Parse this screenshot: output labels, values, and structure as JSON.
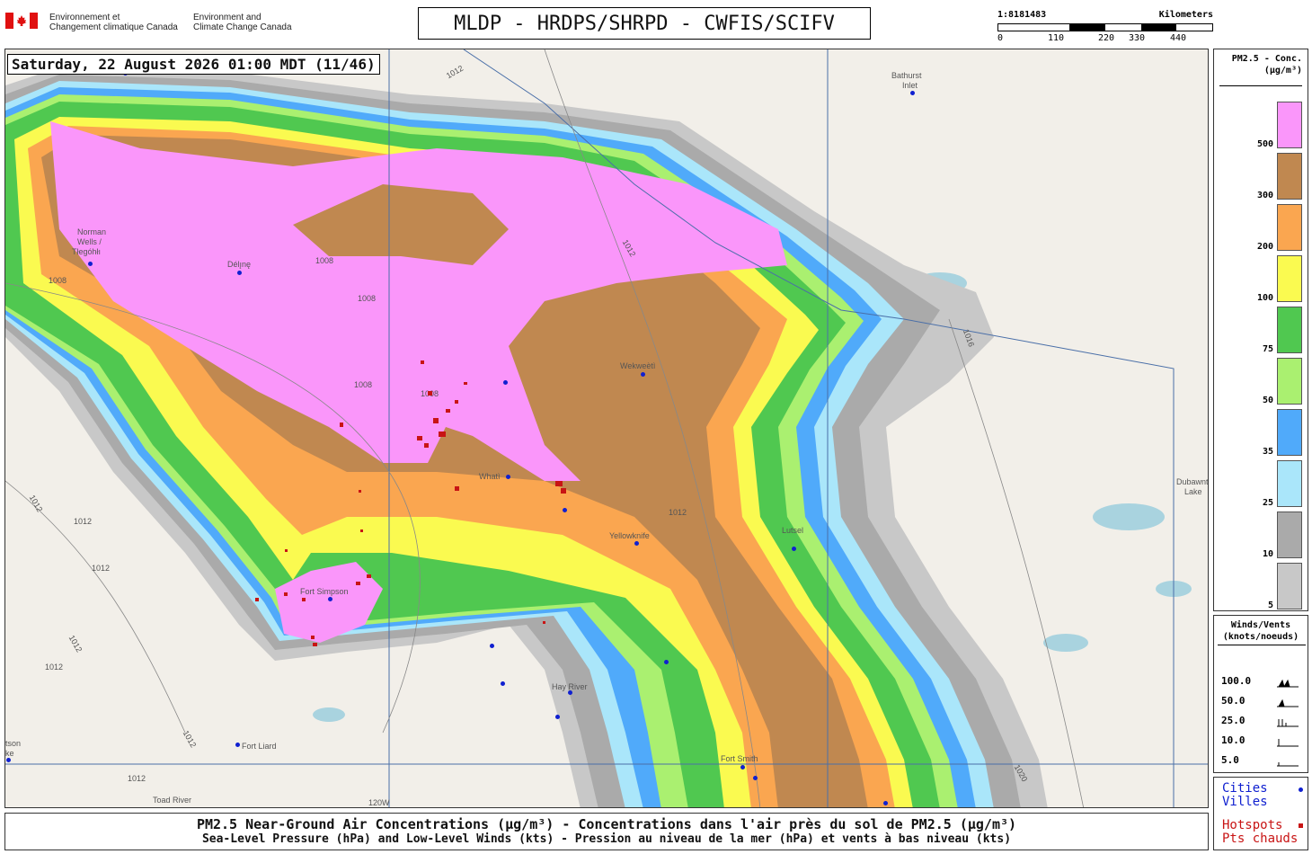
{
  "header": {
    "gov_fr_line1": "Environnement et",
    "gov_fr_line2": "Changement climatique Canada",
    "gov_en_line1": "Environment and",
    "gov_en_line2": "Climate Change Canada",
    "title": "MLDP - HRDPS/SHRPD - CWFIS/SCIFV",
    "scale_ratio": "1:8181483",
    "scale_unit": "Kilometers",
    "scale_ticks": [
      "0",
      "110",
      "220",
      "330",
      "440"
    ]
  },
  "map": {
    "timestamp": "Saturday, 22 August 2026 01:00 MDT (11/46)",
    "cities": [
      {
        "name": "Bathurst",
        "name2": "Inlet"
      },
      {
        "name": "Norman",
        "name2": "Wells /"
      },
      {
        "name": "Tłegóhłı"
      },
      {
        "name": "Délı̨nę"
      },
      {
        "name": "Wekweètì"
      },
      {
        "name": "Whatì"
      },
      {
        "name": "Yellowknife"
      },
      {
        "name": "Lutsel"
      },
      {
        "name": "Fort Simpson"
      },
      {
        "name": "Hay River"
      },
      {
        "name": "Fort Liard"
      },
      {
        "name": "Fort Smith"
      },
      {
        "name": "Toad River"
      },
      {
        "name": "Dubawnt"
      },
      {
        "name": "Lake"
      },
      {
        "name": "tson"
      },
      {
        "name": "ke"
      },
      {
        "name": "120W"
      }
    ],
    "isobar_labels": [
      "1012",
      "1008",
      "1008",
      "1008",
      "1016",
      "1012",
      "1012",
      "1012",
      "1012",
      "1012",
      "1012",
      "1012",
      "1008",
      "1012",
      "1012",
      "1020",
      "1008"
    ]
  },
  "legend": {
    "title_line1": "PM2.5 - Conc.",
    "title_line2": "(µg/m³)",
    "levels": [
      {
        "label": "500",
        "color": "#fa96fa"
      },
      {
        "label": "300",
        "color": "#c08850"
      },
      {
        "label": "200",
        "color": "#faa650"
      },
      {
        "label": "100",
        "color": "#fafa50"
      },
      {
        "label": "75",
        "color": "#50c850"
      },
      {
        "label": "50",
        "color": "#aaf070"
      },
      {
        "label": "35",
        "color": "#50aafa"
      },
      {
        "label": "25",
        "color": "#aae6fa"
      },
      {
        "label": "10",
        "color": "#aaaaaa"
      },
      {
        "label": "5",
        "color": "#c8c8c8"
      }
    ]
  },
  "winds": {
    "title_line1": "Winds/Vents",
    "title_line2": "(knots/noeuds)",
    "rows": [
      "100.0",
      "50.0",
      "25.0",
      "10.0",
      "5.0"
    ]
  },
  "keys": {
    "cities_en": "Cities",
    "cities_fr": "Villes",
    "hotspots_en": "Hotspots",
    "hotspots_fr": "Pts chauds",
    "cities_color": "#1020d0",
    "hotspots_color": "#c81414"
  },
  "footer": {
    "line1": "PM2.5 Near-Ground Air Concentrations (µg/m³) - Concentrations dans l'air près du sol de PM2.5 (µg/m³)",
    "line2": "Sea-Level Pressure (hPa) and Low-Level Winds (kts) - Pression au niveau de la mer (hPa) et vents à bas niveau (kts)"
  }
}
